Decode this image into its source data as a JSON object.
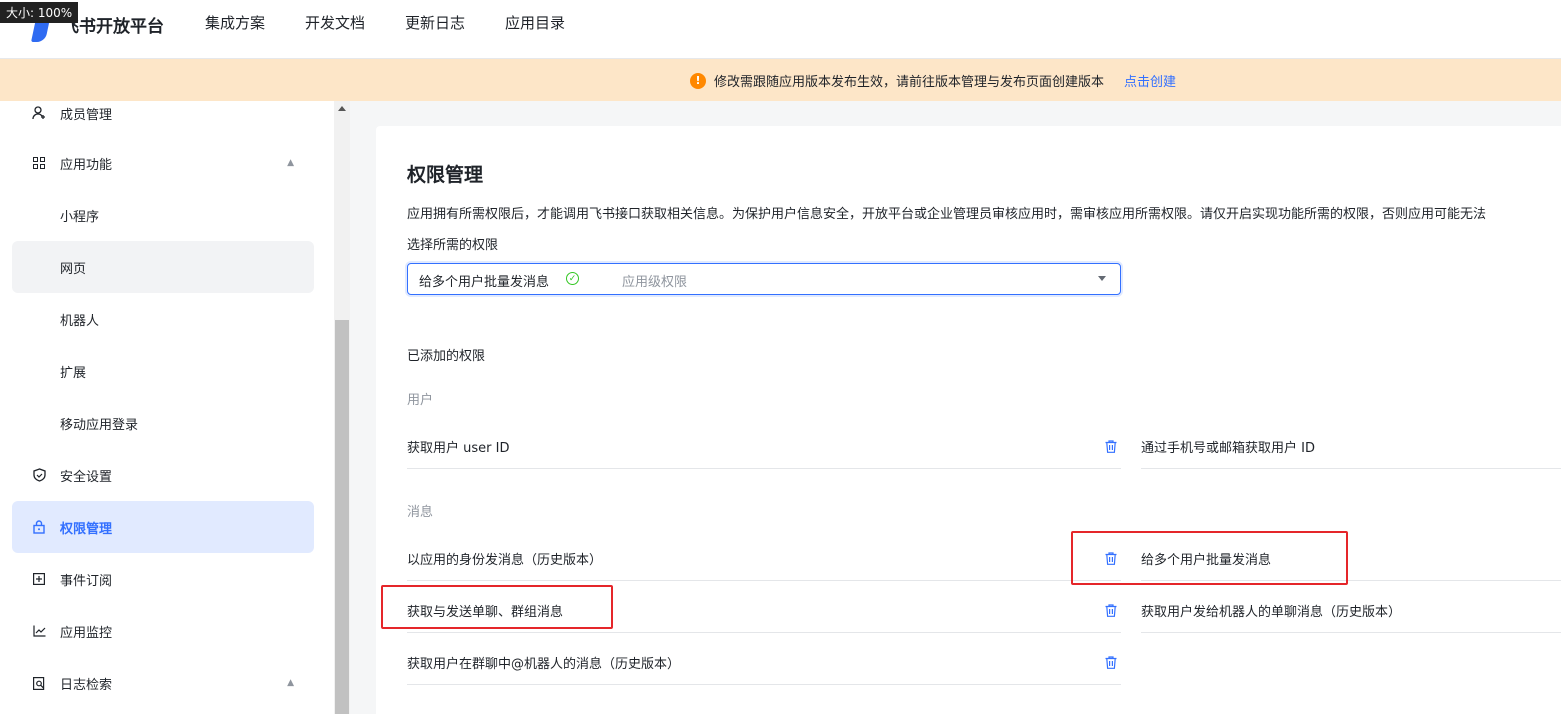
{
  "zoom_badge": "大小: 100%",
  "header": {
    "brand": "飞书开放平台",
    "nav": [
      "集成方案",
      "开发文档",
      "更新日志",
      "应用目录"
    ]
  },
  "banner": {
    "message": "修改需跟随应用版本发布生效，请前往版本管理与发布页面创建版本",
    "link": "点击创建"
  },
  "sidebar": {
    "items": [
      {
        "label": "成员管理",
        "icon": "user-add-icon"
      },
      {
        "label": "应用功能",
        "icon": "grid-icon"
      },
      {
        "label": "小程序"
      },
      {
        "label": "网页"
      },
      {
        "label": "机器人"
      },
      {
        "label": "扩展"
      },
      {
        "label": "移动应用登录"
      },
      {
        "label": "安全设置",
        "icon": "shield-icon"
      },
      {
        "label": "权限管理",
        "icon": "lock-icon"
      },
      {
        "label": "事件订阅",
        "icon": "plus-square-icon"
      },
      {
        "label": "应用监控",
        "icon": "chart-icon"
      },
      {
        "label": "日志检索",
        "icon": "search-doc-icon"
      }
    ]
  },
  "main": {
    "title": "权限管理",
    "description": "应用拥有所需权限后，才能调用飞书接口获取相关信息。为保护用户信息安全，开放平台或企业管理员审核应用时，需审核应用所需权限。请仅开启实现功能所需的权限，否则应用可能无法",
    "select_label": "选择所需的权限",
    "select": {
      "value": "给多个用户批量发消息",
      "level": "应用级权限"
    },
    "added_label": "已添加的权限",
    "groups": {
      "user": {
        "name": "用户",
        "left": [
          "获取用户 user ID"
        ],
        "right": [
          "通过手机号或邮箱获取用户 ID"
        ]
      },
      "message": {
        "name": "消息",
        "left": [
          "以应用的身份发消息（历史版本）",
          "获取与发送单聊、群组消息",
          "获取用户在群聊中@机器人的消息（历史版本）"
        ],
        "right": [
          "给多个用户批量发消息",
          "获取用户发给机器人的单聊消息（历史版本）"
        ]
      }
    }
  },
  "colors": {
    "accent": "#3370ff",
    "banner_bg": "#fde6c8",
    "warning": "#ff8800",
    "highlight_box": "#e5262a"
  }
}
